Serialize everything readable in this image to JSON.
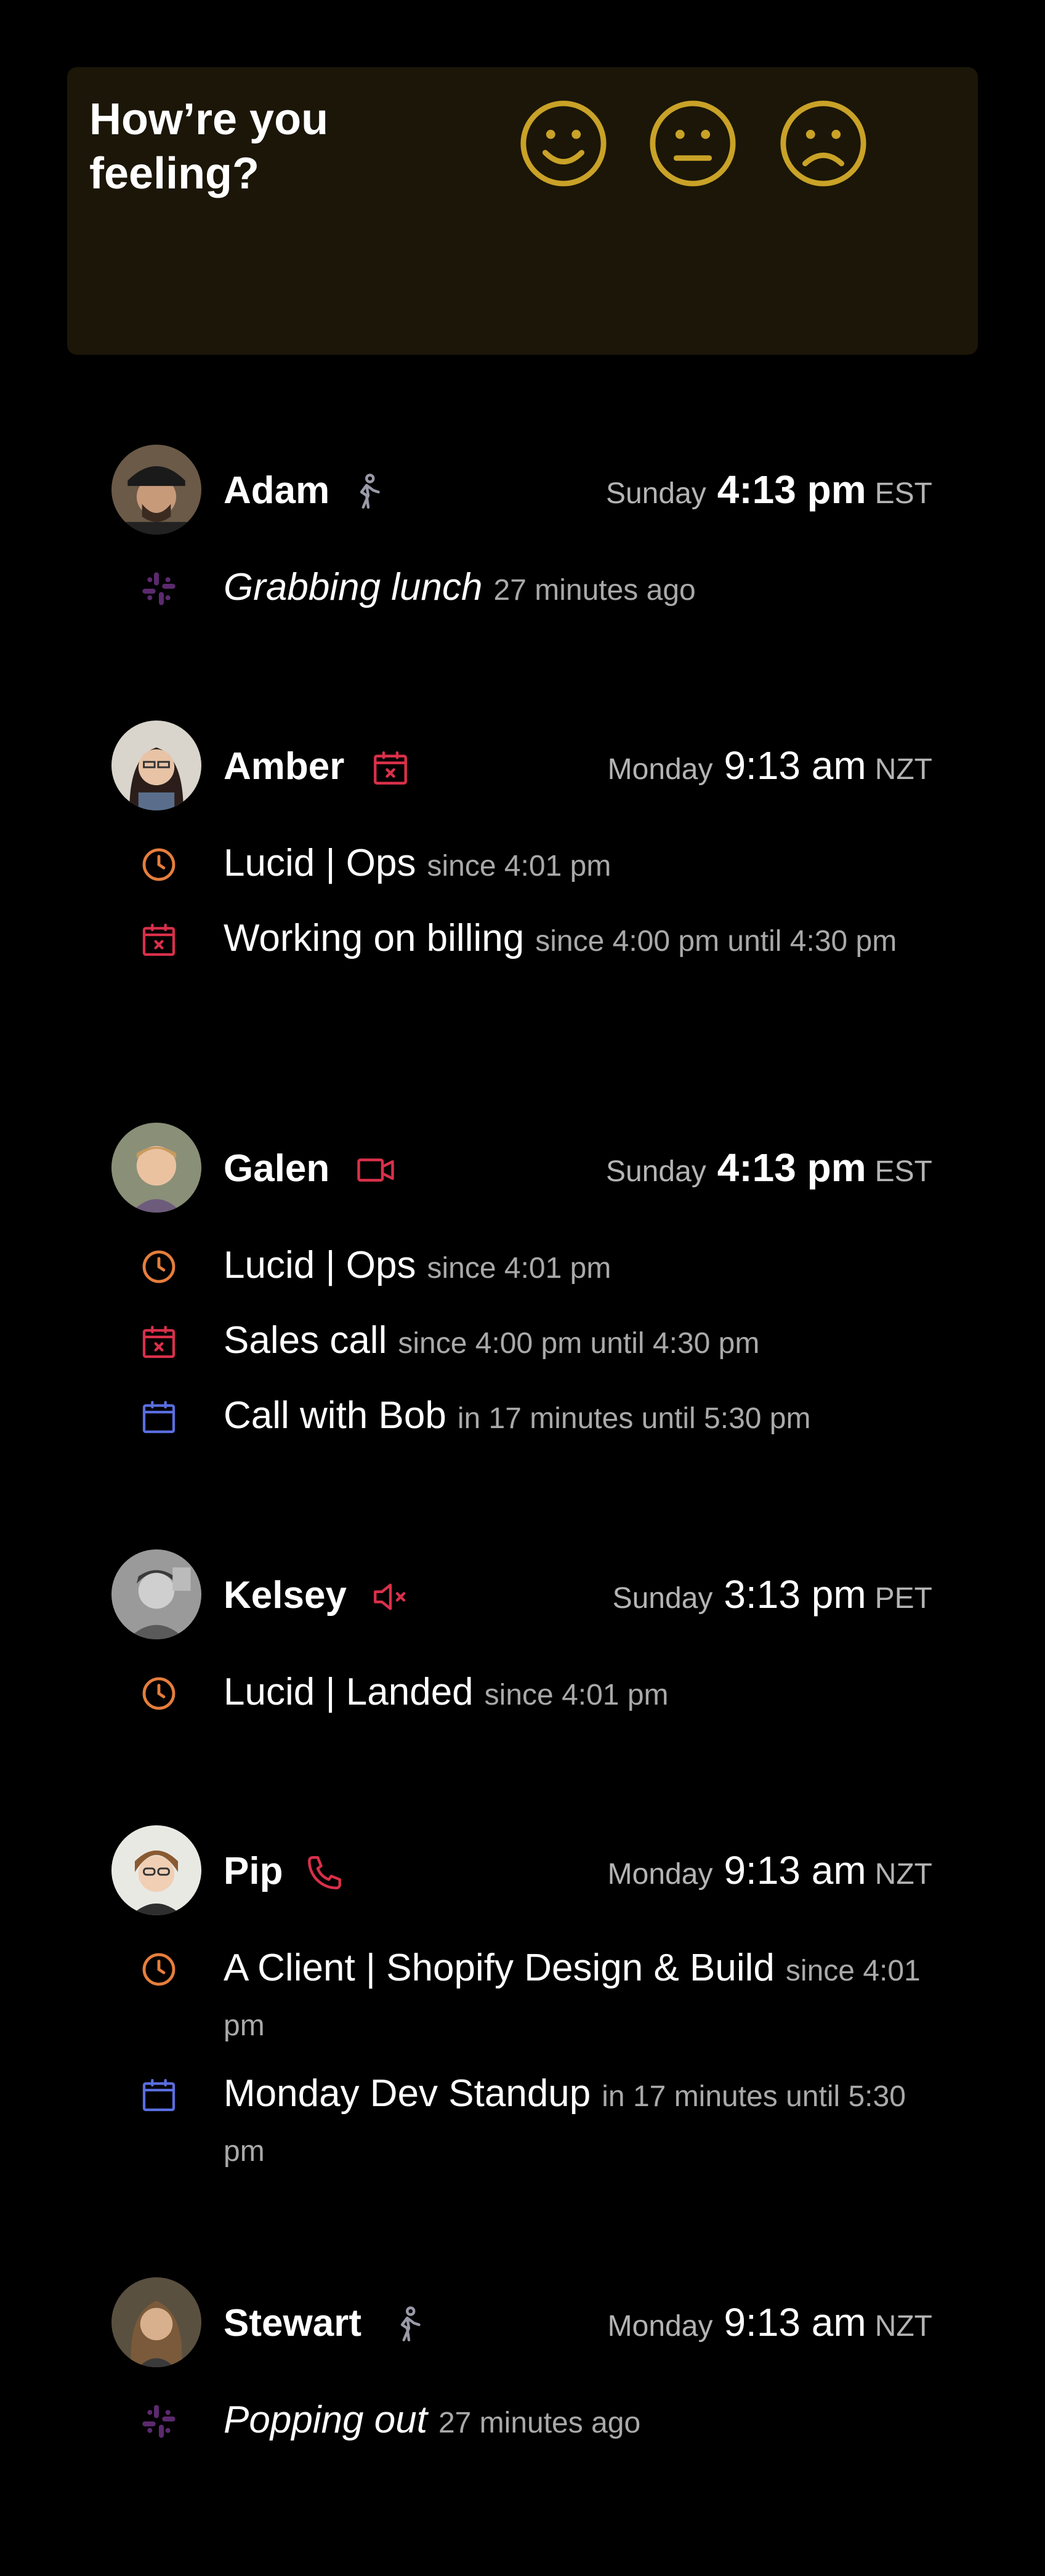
{
  "mood": {
    "title": "How’re you feeling?",
    "options": [
      "happy-face",
      "neutral-face",
      "sad-face"
    ],
    "accent_color": "#c9a227"
  },
  "people": [
    {
      "name": "Adam",
      "status_icon": "walking-person-icon",
      "day": "Sunday",
      "time": "4:13 pm",
      "tz": "EST",
      "time_bold": true,
      "statuses": [
        {
          "icon": "slack-icon",
          "label": "Grabbing lunch",
          "meta": "27 minutes ago"
        }
      ]
    },
    {
      "name": "Amber",
      "status_icon": "calendar-busy-icon",
      "day": "Monday",
      "time": "9:13 am",
      "tz": "NZT",
      "time_bold": false,
      "statuses": [
        {
          "icon": "clock-icon",
          "label": "Lucid | Ops",
          "meta": "since 4:01 pm"
        },
        {
          "icon": "calendar-busy-icon",
          "label": "Working on billing",
          "meta": "since 4:00 pm until 4:30 pm"
        }
      ]
    },
    {
      "name": "Galen",
      "status_icon": "video-camera-icon",
      "day": "Sunday",
      "time": "4:13 pm",
      "tz": "EST",
      "time_bold": true,
      "statuses": [
        {
          "icon": "clock-icon",
          "label": "Lucid | Ops",
          "meta": "since 4:01 pm"
        },
        {
          "icon": "calendar-busy-icon",
          "label": "Sales call",
          "meta": "since 4:00 pm until 4:30 pm"
        },
        {
          "icon": "calendar-icon",
          "label": "Call with Bob",
          "meta": "in 17 minutes until 5:30 pm"
        }
      ]
    },
    {
      "name": "Kelsey",
      "status_icon": "muted-speaker-icon",
      "day": "Sunday",
      "time": "3:13 pm",
      "tz": "PET",
      "time_bold": false,
      "statuses": [
        {
          "icon": "clock-icon",
          "label": "Lucid | Landed",
          "meta": "since 4:01 pm"
        }
      ]
    },
    {
      "name": "Pip",
      "status_icon": "phone-icon",
      "day": "Monday",
      "time": "9:13 am",
      "tz": "NZT",
      "time_bold": false,
      "statuses": [
        {
          "icon": "clock-icon",
          "label": "A Client | Shopify Design & Build",
          "meta": "since 4:01 pm"
        },
        {
          "icon": "calendar-icon",
          "label": "Monday Dev Standup",
          "meta": "in 17 minutes until 5:30 pm"
        }
      ]
    },
    {
      "name": "Stewart",
      "status_icon": "walking-person-icon",
      "day": "Monday",
      "time": "9:13 am",
      "tz": "NZT",
      "time_bold": false,
      "statuses": [
        {
          "icon": "slack-icon",
          "label": "Popping out",
          "meta": "27 minutes ago"
        }
      ]
    }
  ],
  "colors": {
    "clock": "#e67e3c",
    "calendar_busy": "#d9304a",
    "calendar": "#5a6ee0",
    "slack": "#5b2a6e",
    "muted_text": "#b4b4b4"
  }
}
